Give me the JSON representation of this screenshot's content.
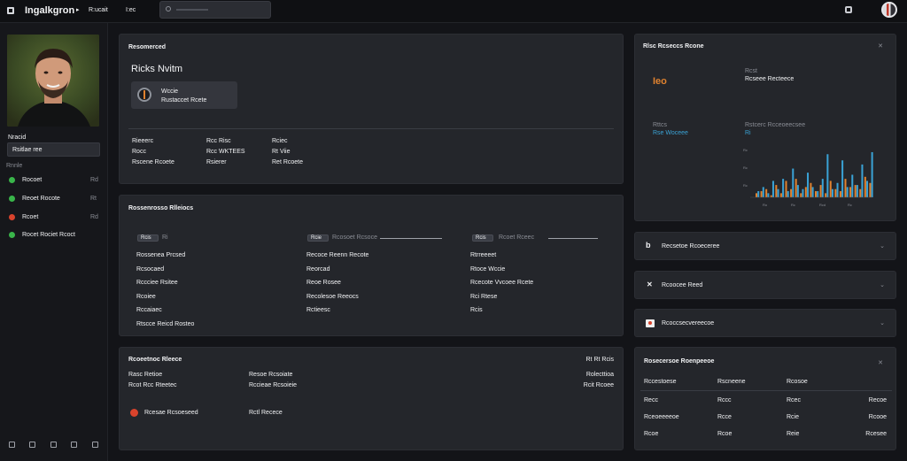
{
  "app": {
    "title": "Ingalkgron",
    "crumb_1": "R:ucait",
    "crumb_2": "I:ec"
  },
  "colors": {
    "accent_orange": "#e0822f",
    "accent_blue": "#3aa3d6",
    "green": "#39b54a",
    "red": "#d9432c"
  },
  "sidebar": {
    "section_label": "Nracid",
    "field_value": "Rsitlae ree",
    "list_label": "Rnnle",
    "items": [
      {
        "label": "Rocoet",
        "count": "Rd",
        "status": "green"
      },
      {
        "label": "Reoet Rocote",
        "count": "Rt",
        "status": "green"
      },
      {
        "label": "Rcoet",
        "count": "Rd",
        "status": "red"
      },
      {
        "label": "Rocet Rociet Rcoct",
        "count": "",
        "status": "green"
      }
    ]
  },
  "profile": {
    "section_title": "Resomerced",
    "name": "Ricks Nvitm",
    "chip_line_1": "Wccie",
    "chip_line_2": "Rustaccet Rcete",
    "stats": [
      [
        "Rieeerc",
        "Rcc Risc",
        "Rciec"
      ],
      [
        "Rocc",
        "Rcc WKTEES",
        "Rt Viie"
      ],
      [
        "Rscene Rcoete",
        "Rsierer",
        "Ret Rcoete"
      ]
    ]
  },
  "details": {
    "title": "Rossenrosso Rlleiocs",
    "columns": [
      {
        "tag": "Rcis",
        "head": "Ri",
        "rows": [
          "Rossenea Prcsed",
          "Rcsocaed",
          "Rccciee Rsitee",
          "Rcoiee",
          "Rccaiaec",
          "Rtscce Reicd Rosteo"
        ]
      },
      {
        "tag": "Rcie",
        "head": "Rcosoet Rcsoce",
        "rows": [
          "Recoce Reenn Recote",
          "Reorcad",
          "Reoe Rosee",
          "Recolesoe Reeocs",
          "Rctieesc"
        ]
      },
      {
        "tag": "Rcis",
        "head": "Rcoet Rceec",
        "rows": [
          "Rtrreeeet",
          "Rtoce Wccie",
          "Rcecote Vvcoee Rcete",
          "Rci Rtese",
          "Rcis"
        ]
      }
    ]
  },
  "summary": {
    "title": "Rcoeetnoc Rleece",
    "right_title": "Rt Rt Rcis",
    "rows": [
      [
        "Rasc Retioe",
        "Resoe Rcsoiate",
        "Rolecttioa"
      ],
      [
        "Rcot Rcc Rteetec",
        "Rccieae Rcsoieie",
        "Rcit Rcoee"
      ]
    ],
    "alert_label": "Rcesae Rcsoeseed",
    "alert_value": "Rctl Recece"
  },
  "metric": {
    "title": "Rlsc Rcseccs Rcone",
    "big_value": "Ieo",
    "label_1": "Rcst",
    "value_1": "Rcseee Recteece",
    "label_2": "Rttcs",
    "value_2": "Rse Woceee",
    "label_3": "Rstcerc Rcceoeecsee",
    "value_3": "Ri"
  },
  "chart_data": {
    "type": "bar",
    "categories": [
      "",
      "",
      "",
      "",
      "",
      "",
      "",
      "",
      "",
      "",
      "",
      "",
      "",
      "",
      "",
      "",
      "",
      "",
      "",
      "",
      "",
      "",
      "",
      ""
    ],
    "series": [
      {
        "color": "#e0822f",
        "values": [
          2,
          3,
          4,
          1,
          6,
          2,
          8,
          4,
          9,
          2,
          5,
          7,
          3,
          6,
          2,
          8,
          4,
          3,
          9,
          5,
          6,
          4,
          10,
          7
        ]
      },
      {
        "color": "#3aa3d6",
        "values": [
          3,
          5,
          2,
          8,
          4,
          9,
          3,
          14,
          6,
          4,
          12,
          5,
          3,
          9,
          21,
          4,
          7,
          18,
          5,
          11,
          6,
          16,
          8,
          22
        ]
      }
    ],
    "tick_labels": [
      "Ro",
      "Rc",
      "Rcd",
      "Rc"
    ],
    "y_ticks": [
      "Rc",
      "Rc",
      "Rc"
    ],
    "ylim": [
      0,
      25
    ]
  },
  "collapsibles": [
    {
      "label": "Recsetoe Rcoeceree",
      "icon": "b"
    },
    {
      "label": "Rcoocee Reed",
      "icon": "x"
    },
    {
      "label": "Rcoccsecvereecoe",
      "icon": "r"
    }
  ],
  "table": {
    "title": "Rosecersoe Roenpeeoe",
    "headers": [
      "Rccestoese",
      "Rscneene",
      "Rcosoe",
      ""
    ],
    "rows": [
      [
        "Recc",
        "Rccc",
        "Rcec",
        "Recoe"
      ],
      [
        "Rceoeeeeoe",
        "Rcce",
        "Rcie",
        "Rcooe"
      ],
      [
        "Rcoe",
        "Rcoe",
        "Reie",
        "Rcesee"
      ]
    ]
  }
}
